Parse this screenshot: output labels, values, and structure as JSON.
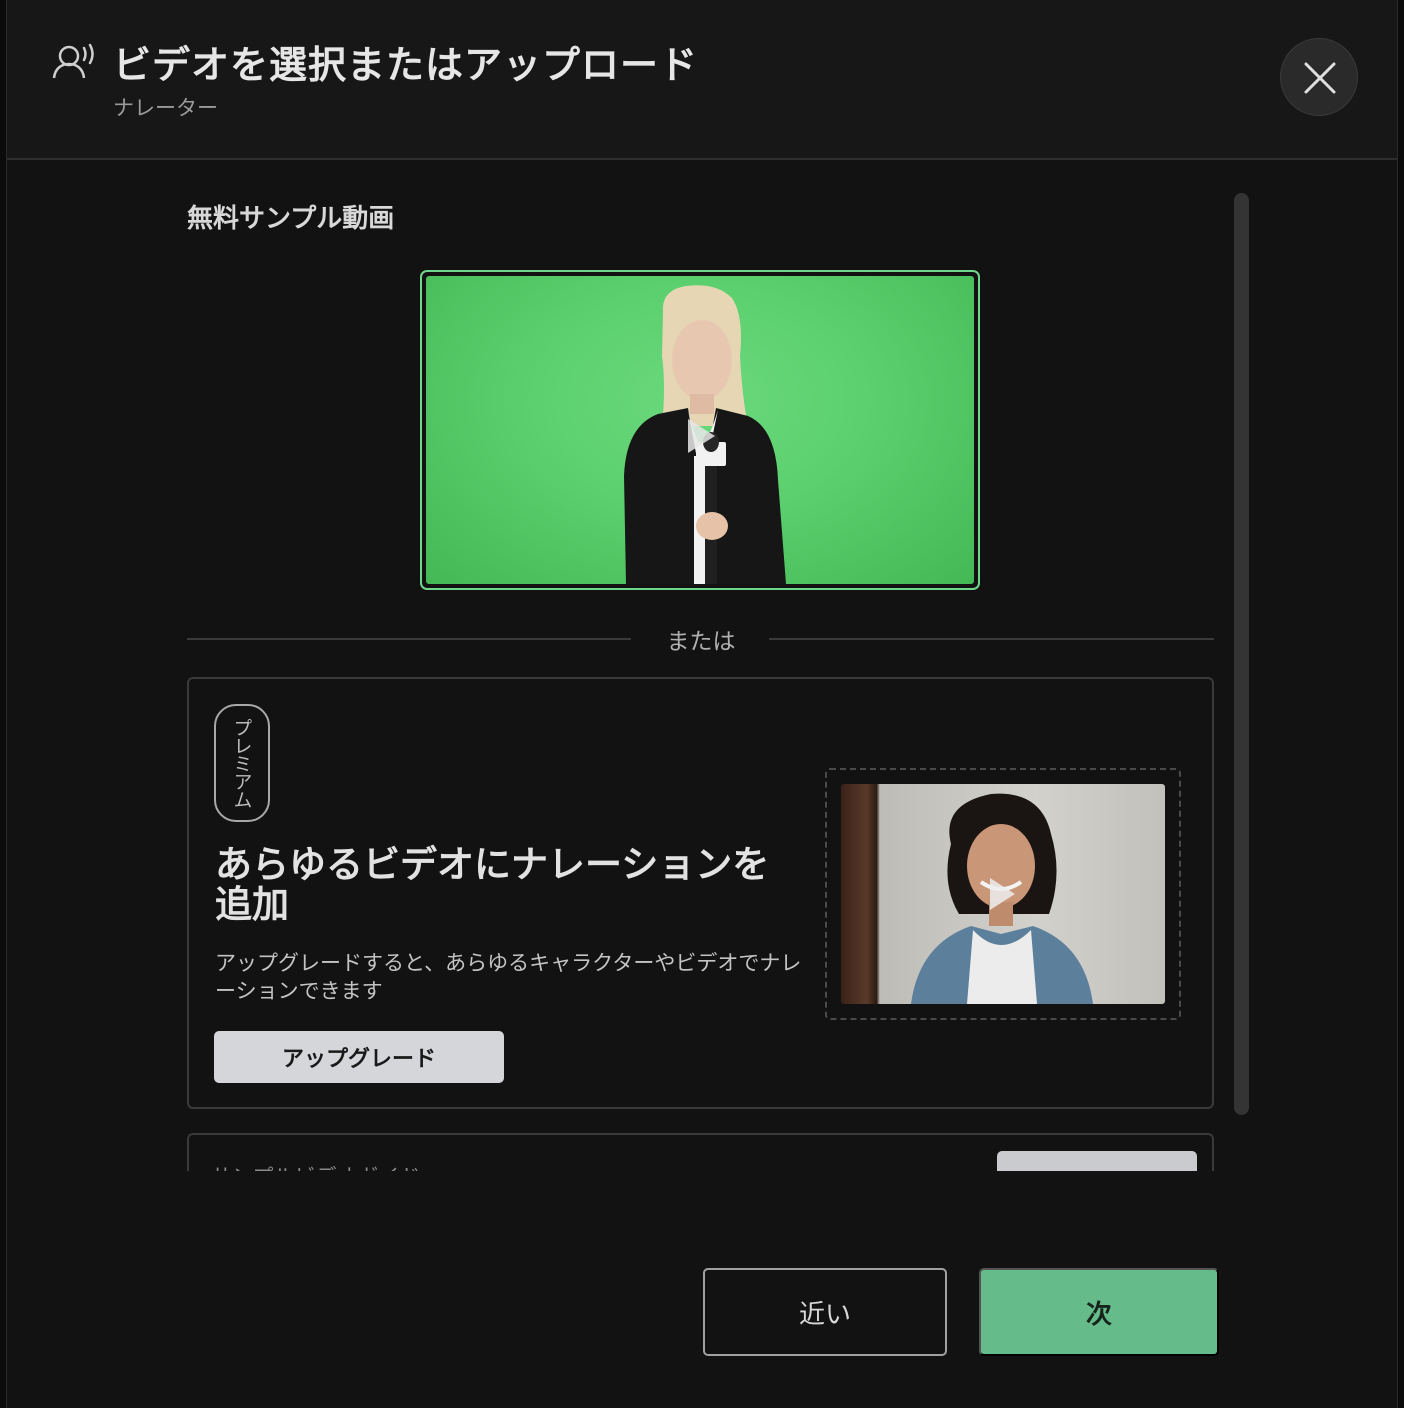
{
  "header": {
    "title": "ビデオを選択またはアップロード",
    "subtitle": "ナレーター",
    "icon": "narrator-icon",
    "close_icon": "close-icon"
  },
  "samples": {
    "section_title": "無料サンプル動画",
    "selected_border_color": "#6fd68c"
  },
  "divider": {
    "label": "または"
  },
  "premium": {
    "badge": "プレミアム",
    "heading": "あらゆるビデオにナレーションを追加",
    "description": "アップグレードすると、あらゆるキャラクターやビデオでナレーションできます",
    "upgrade_label": "アップグレード"
  },
  "next_section": {
    "partial_text": "サンプルビデオガイド"
  },
  "footer": {
    "close_label": "近い",
    "next_label": "次",
    "next_color": "#66bb8a"
  }
}
